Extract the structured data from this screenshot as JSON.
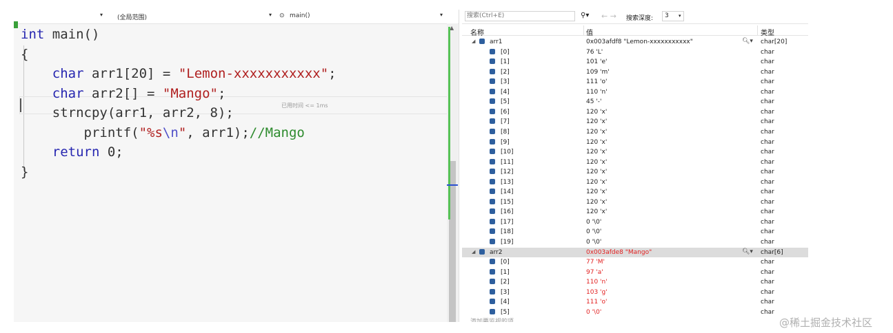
{
  "editor": {
    "nav": {
      "scope_label": "(全局范围)",
      "function_label": "main()"
    },
    "code_lines": [
      [
        {
          "t": "int",
          "c": "kw"
        },
        {
          "t": " main()",
          "c": ""
        }
      ],
      [
        {
          "t": "{",
          "c": ""
        }
      ],
      [
        {
          "t": "    ",
          "c": ""
        },
        {
          "t": "char",
          "c": "kw"
        },
        {
          "t": " arr1[20] = ",
          "c": ""
        },
        {
          "t": "\"Lemon-xxxxxxxxxxx\"",
          "c": "str"
        },
        {
          "t": ";",
          "c": ""
        }
      ],
      [
        {
          "t": "    ",
          "c": ""
        },
        {
          "t": "char",
          "c": "kw"
        },
        {
          "t": " arr2[] = ",
          "c": ""
        },
        {
          "t": "\"Mango\"",
          "c": "str"
        },
        {
          "t": ";",
          "c": ""
        }
      ],
      [
        {
          "t": "    strncpy(arr1, arr2, 8);",
          "c": ""
        }
      ],
      [
        {
          "t": "        printf(",
          "c": ""
        },
        {
          "t": "\"%s",
          "c": "str"
        },
        {
          "t": "\\n",
          "c": "esc"
        },
        {
          "t": "\"",
          "c": "str"
        },
        {
          "t": ", arr1);",
          "c": ""
        },
        {
          "t": "//Mango",
          "c": "cm"
        }
      ],
      [
        {
          "t": "    ",
          "c": ""
        },
        {
          "t": "return",
          "c": "kw"
        },
        {
          "t": " 0;",
          "c": ""
        }
      ],
      [
        {
          "t": "}",
          "c": ""
        }
      ]
    ],
    "perf_tip": "已用时间 <= 1ms"
  },
  "watch": {
    "search_placeholder": "搜索(Ctrl+E)",
    "depth_label": "搜索深度:",
    "depth_value": "3",
    "columns": {
      "name": "名称",
      "value": "值",
      "type": "类型"
    },
    "rows": [
      {
        "level": 0,
        "name": "arr1",
        "value": "0x003afdf8 \"Lemon-xxxxxxxxxxx\"",
        "type": "char[20]",
        "changed": false,
        "selected": false
      },
      {
        "level": 1,
        "name": "[0]",
        "value": "76 'L'",
        "type": "char",
        "changed": false
      },
      {
        "level": 1,
        "name": "[1]",
        "value": "101 'e'",
        "type": "char",
        "changed": false
      },
      {
        "level": 1,
        "name": "[2]",
        "value": "109 'm'",
        "type": "char",
        "changed": false
      },
      {
        "level": 1,
        "name": "[3]",
        "value": "111 'o'",
        "type": "char",
        "changed": false
      },
      {
        "level": 1,
        "name": "[4]",
        "value": "110 'n'",
        "type": "char",
        "changed": false
      },
      {
        "level": 1,
        "name": "[5]",
        "value": "45 '-'",
        "type": "char",
        "changed": false
      },
      {
        "level": 1,
        "name": "[6]",
        "value": "120 'x'",
        "type": "char",
        "changed": false
      },
      {
        "level": 1,
        "name": "[7]",
        "value": "120 'x'",
        "type": "char",
        "changed": false
      },
      {
        "level": 1,
        "name": "[8]",
        "value": "120 'x'",
        "type": "char",
        "changed": false
      },
      {
        "level": 1,
        "name": "[9]",
        "value": "120 'x'",
        "type": "char",
        "changed": false
      },
      {
        "level": 1,
        "name": "[10]",
        "value": "120 'x'",
        "type": "char",
        "changed": false
      },
      {
        "level": 1,
        "name": "[11]",
        "value": "120 'x'",
        "type": "char",
        "changed": false
      },
      {
        "level": 1,
        "name": "[12]",
        "value": "120 'x'",
        "type": "char",
        "changed": false
      },
      {
        "level": 1,
        "name": "[13]",
        "value": "120 'x'",
        "type": "char",
        "changed": false
      },
      {
        "level": 1,
        "name": "[14]",
        "value": "120 'x'",
        "type": "char",
        "changed": false
      },
      {
        "level": 1,
        "name": "[15]",
        "value": "120 'x'",
        "type": "char",
        "changed": false
      },
      {
        "level": 1,
        "name": "[16]",
        "value": "120 'x'",
        "type": "char",
        "changed": false
      },
      {
        "level": 1,
        "name": "[17]",
        "value": "0 '\\0'",
        "type": "char",
        "changed": false
      },
      {
        "level": 1,
        "name": "[18]",
        "value": "0 '\\0'",
        "type": "char",
        "changed": false
      },
      {
        "level": 1,
        "name": "[19]",
        "value": "0 '\\0'",
        "type": "char",
        "changed": false
      },
      {
        "level": 0,
        "name": "arr2",
        "value": "0x003afde8 \"Mango\"",
        "type": "char[6]",
        "changed": true,
        "selected": true
      },
      {
        "level": 1,
        "name": "[0]",
        "value": "77 'M'",
        "type": "char",
        "changed": true
      },
      {
        "level": 1,
        "name": "[1]",
        "value": "97 'a'",
        "type": "char",
        "changed": true
      },
      {
        "level": 1,
        "name": "[2]",
        "value": "110 'n'",
        "type": "char",
        "changed": true
      },
      {
        "level": 1,
        "name": "[3]",
        "value": "103 'g'",
        "type": "char",
        "changed": true
      },
      {
        "level": 1,
        "name": "[4]",
        "value": "111 'o'",
        "type": "char",
        "changed": true
      },
      {
        "level": 1,
        "name": "[5]",
        "value": "0 '\\0'",
        "type": "char",
        "changed": true
      }
    ],
    "add_item_label": "添加要监视的项"
  },
  "watermark": "@稀土掘金技术社区",
  "colors": {
    "keyword": "#2626b0",
    "string": "#b02020",
    "comment": "#2e8b2e",
    "changed_value": "#e22020"
  }
}
